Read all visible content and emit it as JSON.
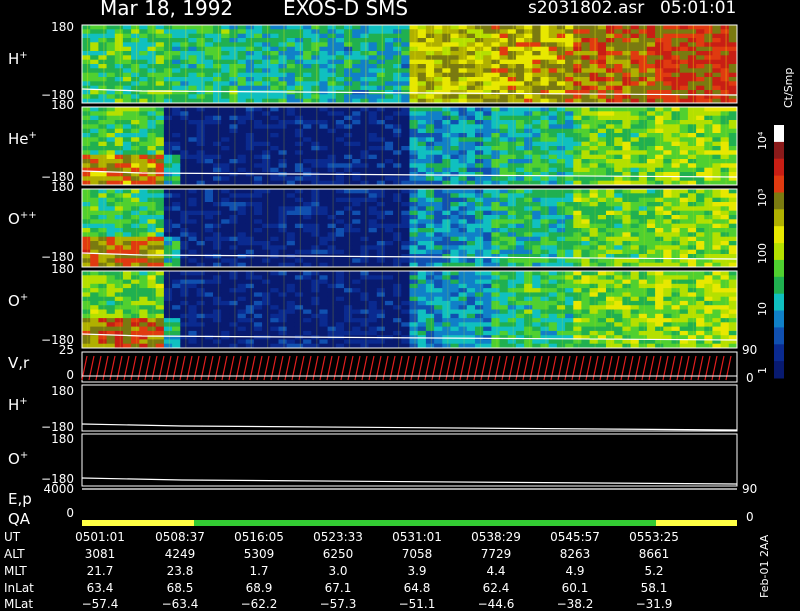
{
  "header": {
    "date": "Mar 18, 1992",
    "instrument": "EXOS-D SMS",
    "file": "s2031802.asr",
    "time": "05:01:01"
  },
  "colors": {
    "axis": "#ffffff",
    "low": "#0a1a8c",
    "high": "#c81e14",
    "velocity_trace": "#e01e1e",
    "qa_yellow": "#ffff44",
    "qa_green": "#33cc33"
  },
  "colorbar": {
    "unit_label": "Ct/Smp",
    "ticks": [
      "10⁴",
      "10³",
      "100",
      "10",
      "1"
    ],
    "colors": [
      "#ffffff",
      "#8a1a1a",
      "#c81e14",
      "#e03a10",
      "#7a7a10",
      "#b0b000",
      "#e8e800",
      "#b4e000",
      "#50d030",
      "#20b050",
      "#10c0c0",
      "#1080c8",
      "#1050b0",
      "#0a2a90",
      "#081a70"
    ]
  },
  "panels": [
    {
      "label": "H",
      "sup": "+",
      "ymax": "180",
      "ymin": "−180"
    },
    {
      "label": "He",
      "sup": "+",
      "ymax": "180",
      "ymin": "−180"
    },
    {
      "label": "O",
      "sup": "++",
      "ymax": "180",
      "ymin": "−180"
    },
    {
      "label": "O",
      "sup": "+",
      "ymax": "180",
      "ymin": "−180"
    }
  ],
  "vr_panel": {
    "label": "V,r",
    "ymax": "25",
    "ymin": "0",
    "right_max": "90",
    "right_min": "0"
  },
  "line_panels": [
    {
      "label": "H",
      "sup": "+",
      "ymax": "180",
      "ymin": "−180"
    },
    {
      "label": "O",
      "sup": "+",
      "ymax": "180",
      "ymin": "−180"
    }
  ],
  "ep_panel": {
    "label": "E,p",
    "ymax": "4000",
    "right": "90"
  },
  "qa_panel": {
    "label": "QA",
    "ymin": "0",
    "right": "0"
  },
  "table": {
    "rows": [
      {
        "name": "UT",
        "values": [
          "0501:01",
          "0508:37",
          "0516:05",
          "0523:33",
          "0531:01",
          "0538:29",
          "0545:57",
          "0553:25"
        ]
      },
      {
        "name": "ALT",
        "values": [
          "3081",
          "4249",
          "5309",
          "6250",
          "7058",
          "7729",
          "8263",
          "8661"
        ]
      },
      {
        "name": "MLT",
        "values": [
          "21.7",
          "23.8",
          "1.7",
          "3.0",
          "3.9",
          "4.4",
          "4.9",
          "5.2"
        ]
      },
      {
        "name": "InLat",
        "values": [
          "63.4",
          "68.5",
          "68.9",
          "67.1",
          "64.8",
          "62.4",
          "60.1",
          "58.1"
        ]
      },
      {
        "name": "MLat",
        "values": [
          "−57.4",
          "−63.4",
          "−62.2",
          "−57.3",
          "−51.1",
          "−44.6",
          "−38.2",
          "−31.9"
        ]
      }
    ]
  },
  "footer_note": "Feb-01 2AA",
  "chart_data": {
    "type": "heatmap",
    "title": "Mar 18, 1992   EXOS-D SMS",
    "x": [
      "0501:01",
      "0508:37",
      "0516:05",
      "0523:33",
      "0531:01",
      "0538:29",
      "0545:57",
      "0553:25"
    ],
    "series": [
      {
        "name": "H+",
        "ylim": [
          -180,
          180
        ],
        "intensity_by_segment": [
          0.45,
          0.42,
          0.38,
          0.35,
          0.7,
          0.75,
          0.85,
          0.9
        ]
      },
      {
        "name": "He+",
        "ylim": [
          -180,
          180
        ],
        "intensity_by_segment": [
          0.45,
          0.05,
          0.05,
          0.05,
          0.3,
          0.4,
          0.5,
          0.55
        ]
      },
      {
        "name": "O++",
        "ylim": [
          -180,
          180
        ],
        "intensity_by_segment": [
          0.45,
          0.05,
          0.05,
          0.05,
          0.3,
          0.4,
          0.5,
          0.55
        ]
      },
      {
        "name": "O+",
        "ylim": [
          -180,
          180
        ],
        "intensity_by_segment": [
          0.5,
          0.05,
          0.05,
          0.05,
          0.3,
          0.42,
          0.52,
          0.55
        ]
      }
    ],
    "colorbar_range": [
      1,
      10000
    ],
    "colorbar_label": "Ct/Smp"
  }
}
